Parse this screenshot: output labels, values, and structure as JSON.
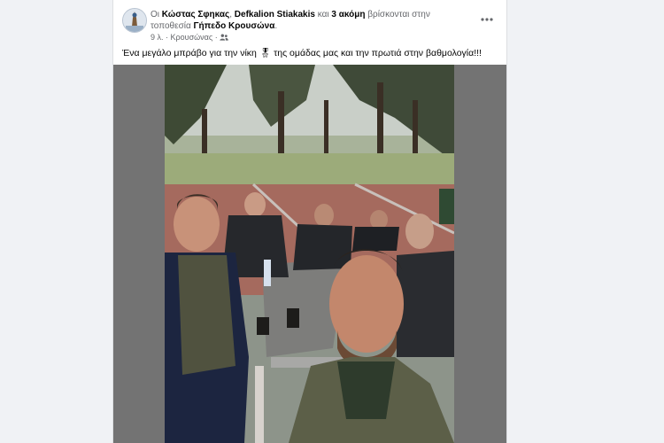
{
  "post": {
    "header": {
      "prefix": "Οι",
      "person1": "Κώστας Σφηκας",
      "sep1": ",",
      "person2": "Defkalion Stiakakis",
      "and": "και",
      "others": "3 ακόμη",
      "located": "βρίσκονται στην τοποθεσία",
      "place": "Γήπεδο Κρουσώνα",
      "end": "."
    },
    "meta": {
      "time": "9 λ.",
      "dot": "·",
      "location": "Κρουσώνας",
      "dot2": "·",
      "audience_icon": "friends-icon"
    },
    "more_icon": "more-options-icon",
    "caption": {
      "text_before": "Ένα μεγάλο μπράβο για την νίκη",
      "emoji": "🎖",
      "text_after": "της ομάδας μας και την πρωτιά στην βαθμολογία!!!"
    }
  },
  "colors": {
    "name": "#050505",
    "secondary": "#65676b",
    "media_bg": "#737373"
  }
}
